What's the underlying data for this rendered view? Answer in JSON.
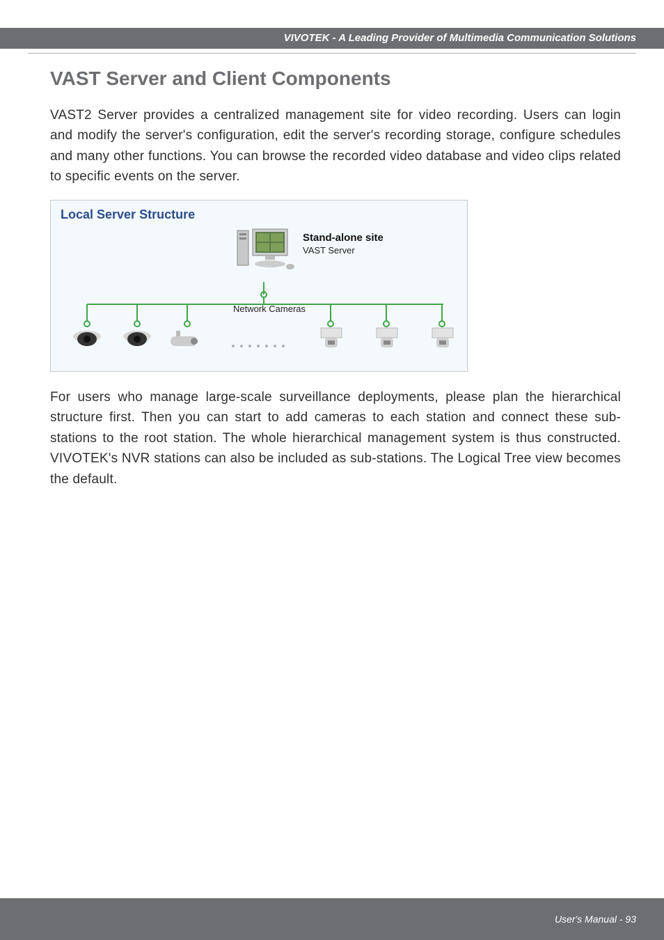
{
  "header": {
    "brand": "VIVOTEK - A Leading Provider of Multimedia Communication Solutions"
  },
  "section": {
    "title": "VAST Server and Client Components"
  },
  "para1": "VAST2 Server provides a centralized management site for video recording. Users can login and modify the server's configuration, edit the server's recording storage, configure schedules and many other functions. You can browse the recorded video database and video clips related to specific events on the server.",
  "diagram": {
    "title": "Local Server Structure",
    "server_label_bold": "Stand-alone site",
    "server_label_sub": "VAST Server",
    "network_label": "Network Cameras"
  },
  "para2": "For users who manage large-scale surveillance deployments, please plan the hierarchical structure first. Then you can start to add cameras to each station and connect these sub-stations to the root station. The whole hierarchical management system is thus constructed. VIVOTEK's NVR stations can also be included as sub-stations. The Logical Tree view becomes the default.",
  "footer": {
    "text": "User's Manual - 93"
  }
}
